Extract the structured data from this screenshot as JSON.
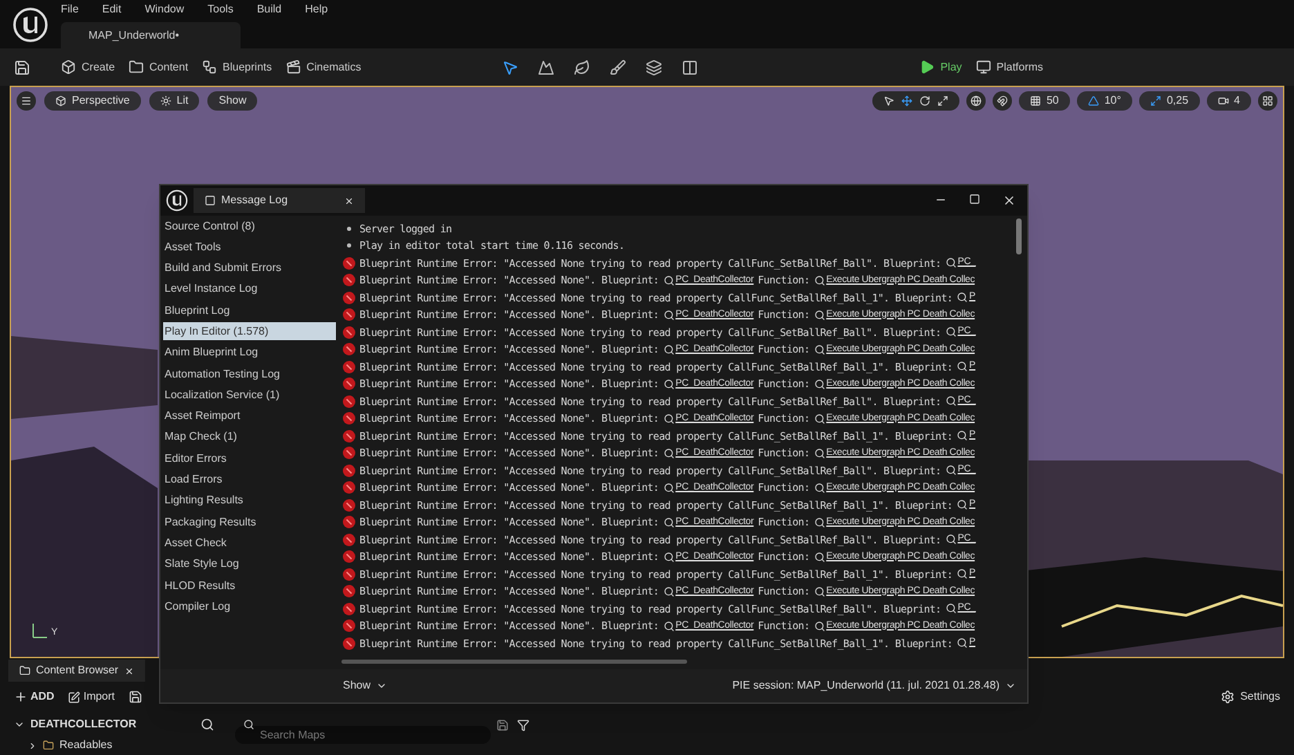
{
  "menu": [
    "File",
    "Edit",
    "Window",
    "Tools",
    "Build",
    "Help"
  ],
  "document_tab": {
    "label": "MAP_Underworld•"
  },
  "toolbar": {
    "items": [
      "Create",
      "Content",
      "Blueprints",
      "Cinematics"
    ],
    "play": "Play",
    "platforms": "Platforms"
  },
  "viewport": {
    "buttons": [
      "Perspective",
      "Lit",
      "Show"
    ],
    "readouts": [
      "50",
      "10°",
      "0,25",
      "4"
    ],
    "gizmo_label": "Y"
  },
  "message_log": {
    "title": "Message Log",
    "categories": [
      {
        "label": "Source Control (8)",
        "selected": false
      },
      {
        "label": "Asset Tools",
        "selected": false
      },
      {
        "label": "Build and Submit Errors",
        "selected": false
      },
      {
        "label": "Level Instance Log",
        "selected": false
      },
      {
        "label": "Blueprint Log",
        "selected": false
      },
      {
        "label": "Play In Editor (1.578)",
        "selected": true
      },
      {
        "label": "Anim Blueprint Log",
        "selected": false
      },
      {
        "label": "Automation Testing Log",
        "selected": false
      },
      {
        "label": "Localization Service (1)",
        "selected": false
      },
      {
        "label": "Asset Reimport",
        "selected": false
      },
      {
        "label": "Map Check (1)",
        "selected": false
      },
      {
        "label": "Editor Errors",
        "selected": false
      },
      {
        "label": "Load Errors",
        "selected": false
      },
      {
        "label": "Lighting Results",
        "selected": false
      },
      {
        "label": "Packaging Results",
        "selected": false
      },
      {
        "label": "Asset Check",
        "selected": false
      },
      {
        "label": "Slate Style Log",
        "selected": false
      },
      {
        "label": "HLOD Results",
        "selected": false
      },
      {
        "label": "Compiler Log",
        "selected": false
      }
    ],
    "entries": [
      {
        "kind": "info",
        "parts": [
          {
            "kind": "text",
            "text": "Server logged in"
          }
        ]
      },
      {
        "kind": "info",
        "parts": [
          {
            "kind": "text",
            "text": "Play in editor total start time 0.116 seconds."
          }
        ]
      },
      {
        "kind": "error",
        "parts": [
          {
            "kind": "text",
            "text": "Blueprint Runtime Error: \"Accessed None trying to read property CallFunc_SetBallRef_Ball\". Blueprint:"
          },
          {
            "kind": "link",
            "text": "PC_"
          }
        ]
      },
      {
        "kind": "error",
        "parts": [
          {
            "kind": "text",
            "text": "Blueprint Runtime Error: \"Accessed None\". Blueprint:"
          },
          {
            "kind": "link",
            "text": "PC_DeathCollector"
          },
          {
            "kind": "text",
            "text": "Function:"
          },
          {
            "kind": "link",
            "text": "Execute Ubergraph PC Death Collec"
          }
        ]
      },
      {
        "kind": "error",
        "parts": [
          {
            "kind": "text",
            "text": "Blueprint Runtime Error: \"Accessed None trying to read property CallFunc_SetBallRef_Ball_1\". Blueprint:"
          },
          {
            "kind": "link",
            "text": "P"
          }
        ]
      },
      {
        "kind": "error",
        "parts": [
          {
            "kind": "text",
            "text": "Blueprint Runtime Error: \"Accessed None\". Blueprint:"
          },
          {
            "kind": "link",
            "text": "PC_DeathCollector"
          },
          {
            "kind": "text",
            "text": "Function:"
          },
          {
            "kind": "link",
            "text": "Execute Ubergraph PC Death Collec"
          }
        ]
      },
      {
        "kind": "error",
        "parts": [
          {
            "kind": "text",
            "text": "Blueprint Runtime Error: \"Accessed None trying to read property CallFunc_SetBallRef_Ball\". Blueprint:"
          },
          {
            "kind": "link",
            "text": "PC_"
          }
        ]
      },
      {
        "kind": "error",
        "parts": [
          {
            "kind": "text",
            "text": "Blueprint Runtime Error: \"Accessed None\". Blueprint:"
          },
          {
            "kind": "link",
            "text": "PC_DeathCollector"
          },
          {
            "kind": "text",
            "text": "Function:"
          },
          {
            "kind": "link",
            "text": "Execute Ubergraph PC Death Collec"
          }
        ]
      },
      {
        "kind": "error",
        "parts": [
          {
            "kind": "text",
            "text": "Blueprint Runtime Error: \"Accessed None trying to read property CallFunc_SetBallRef_Ball_1\". Blueprint:"
          },
          {
            "kind": "link",
            "text": "P"
          }
        ]
      },
      {
        "kind": "error",
        "parts": [
          {
            "kind": "text",
            "text": "Blueprint Runtime Error: \"Accessed None\". Blueprint:"
          },
          {
            "kind": "link",
            "text": "PC_DeathCollector"
          },
          {
            "kind": "text",
            "text": "Function:"
          },
          {
            "kind": "link",
            "text": "Execute Ubergraph PC Death Collec"
          }
        ]
      },
      {
        "kind": "error",
        "parts": [
          {
            "kind": "text",
            "text": "Blueprint Runtime Error: \"Accessed None trying to read property CallFunc_SetBallRef_Ball\". Blueprint:"
          },
          {
            "kind": "link",
            "text": "PC_"
          }
        ]
      },
      {
        "kind": "error",
        "parts": [
          {
            "kind": "text",
            "text": "Blueprint Runtime Error: \"Accessed None\". Blueprint:"
          },
          {
            "kind": "link",
            "text": "PC_DeathCollector"
          },
          {
            "kind": "text",
            "text": "Function:"
          },
          {
            "kind": "link",
            "text": "Execute Ubergraph PC Death Collec"
          }
        ]
      },
      {
        "kind": "error",
        "parts": [
          {
            "kind": "text",
            "text": "Blueprint Runtime Error: \"Accessed None trying to read property CallFunc_SetBallRef_Ball_1\". Blueprint:"
          },
          {
            "kind": "link",
            "text": "P"
          }
        ]
      },
      {
        "kind": "error",
        "parts": [
          {
            "kind": "text",
            "text": "Blueprint Runtime Error: \"Accessed None\". Blueprint:"
          },
          {
            "kind": "link",
            "text": "PC_DeathCollector"
          },
          {
            "kind": "text",
            "text": "Function:"
          },
          {
            "kind": "link",
            "text": "Execute Ubergraph PC Death Collec"
          }
        ]
      },
      {
        "kind": "error",
        "parts": [
          {
            "kind": "text",
            "text": "Blueprint Runtime Error: \"Accessed None trying to read property CallFunc_SetBallRef_Ball\". Blueprint:"
          },
          {
            "kind": "link",
            "text": "PC_"
          }
        ]
      },
      {
        "kind": "error",
        "parts": [
          {
            "kind": "text",
            "text": "Blueprint Runtime Error: \"Accessed None\". Blueprint:"
          },
          {
            "kind": "link",
            "text": "PC_DeathCollector"
          },
          {
            "kind": "text",
            "text": "Function:"
          },
          {
            "kind": "link",
            "text": "Execute Ubergraph PC Death Collec"
          }
        ]
      },
      {
        "kind": "error",
        "parts": [
          {
            "kind": "text",
            "text": "Blueprint Runtime Error: \"Accessed None trying to read property CallFunc_SetBallRef_Ball_1\". Blueprint:"
          },
          {
            "kind": "link",
            "text": "P"
          }
        ]
      },
      {
        "kind": "error",
        "parts": [
          {
            "kind": "text",
            "text": "Blueprint Runtime Error: \"Accessed None\". Blueprint:"
          },
          {
            "kind": "link",
            "text": "PC_DeathCollector"
          },
          {
            "kind": "text",
            "text": "Function:"
          },
          {
            "kind": "link",
            "text": "Execute Ubergraph PC Death Collec"
          }
        ]
      },
      {
        "kind": "error",
        "parts": [
          {
            "kind": "text",
            "text": "Blueprint Runtime Error: \"Accessed None trying to read property CallFunc_SetBallRef_Ball\". Blueprint:"
          },
          {
            "kind": "link",
            "text": "PC_"
          }
        ]
      },
      {
        "kind": "error",
        "parts": [
          {
            "kind": "text",
            "text": "Blueprint Runtime Error: \"Accessed None\". Blueprint:"
          },
          {
            "kind": "link",
            "text": "PC_DeathCollector"
          },
          {
            "kind": "text",
            "text": "Function:"
          },
          {
            "kind": "link",
            "text": "Execute Ubergraph PC Death Collec"
          }
        ]
      },
      {
        "kind": "error",
        "parts": [
          {
            "kind": "text",
            "text": "Blueprint Runtime Error: \"Accessed None trying to read property CallFunc_SetBallRef_Ball_1\". Blueprint:"
          },
          {
            "kind": "link",
            "text": "P"
          }
        ]
      },
      {
        "kind": "error",
        "parts": [
          {
            "kind": "text",
            "text": "Blueprint Runtime Error: \"Accessed None\". Blueprint:"
          },
          {
            "kind": "link",
            "text": "PC_DeathCollector"
          },
          {
            "kind": "text",
            "text": "Function:"
          },
          {
            "kind": "link",
            "text": "Execute Ubergraph PC Death Collec"
          }
        ]
      },
      {
        "kind": "error",
        "parts": [
          {
            "kind": "text",
            "text": "Blueprint Runtime Error: \"Accessed None trying to read property CallFunc_SetBallRef_Ball\". Blueprint:"
          },
          {
            "kind": "link",
            "text": "PC_"
          }
        ]
      },
      {
        "kind": "error",
        "parts": [
          {
            "kind": "text",
            "text": "Blueprint Runtime Error: \"Accessed None\". Blueprint:"
          },
          {
            "kind": "link",
            "text": "PC_DeathCollector"
          },
          {
            "kind": "text",
            "text": "Function:"
          },
          {
            "kind": "link",
            "text": "Execute Ubergraph PC Death Collec"
          }
        ]
      },
      {
        "kind": "error",
        "parts": [
          {
            "kind": "text",
            "text": "Blueprint Runtime Error: \"Accessed None trying to read property CallFunc_SetBallRef_Ball_1\". Blueprint:"
          },
          {
            "kind": "link",
            "text": "P"
          }
        ]
      }
    ],
    "show": "Show",
    "session": "PIE session: MAP_Underworld (11. jul. 2021 01.28.48)"
  },
  "content_browser": {
    "title": "Content Browser",
    "add": "ADD",
    "import": "Import",
    "root": "DEATHCOLLECTOR",
    "search": {
      "placeholder": "Search Maps"
    },
    "folders": [
      "Readables"
    ],
    "settings": "Settings"
  }
}
